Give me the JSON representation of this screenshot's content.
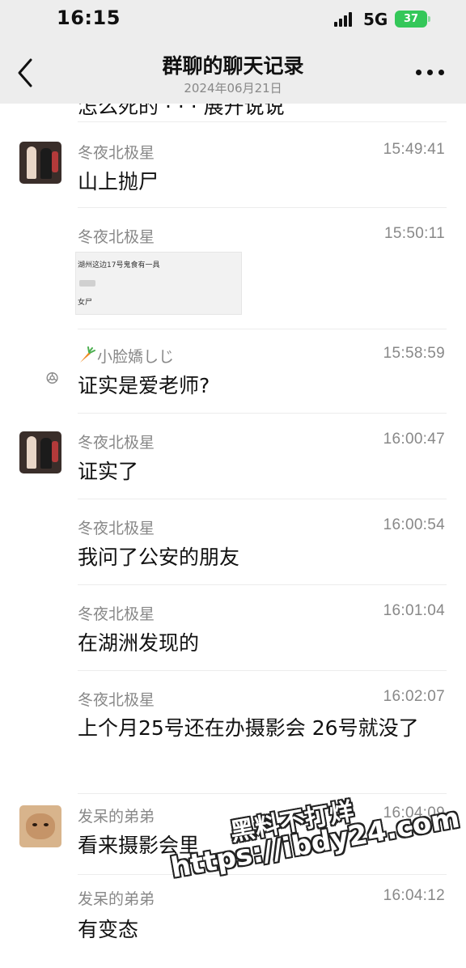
{
  "status_bar": {
    "time": "16:15",
    "network": "5G",
    "battery": "37"
  },
  "nav": {
    "title": "群聊的聊天记录",
    "subtitle": "2024年06月21日"
  },
  "partial_top_text": "怎么死的 · · · 展开说说",
  "messages": [
    {
      "sender": "冬夜北极星",
      "time": "15:49:41",
      "text": "山上抛尸",
      "avatar": "dark"
    },
    {
      "sender": "冬夜北极星",
      "time": "15:50:11",
      "image": {
        "line1": "湖州这边17号鬼食有一具",
        "line2": "女尸"
      }
    },
    {
      "sender": "小脸嬌しじ",
      "time": "15:58:59",
      "text": "证实是爱老师?",
      "avatar": "bunny"
    },
    {
      "sender": "冬夜北极星",
      "time": "16:00:47",
      "text": "证实了",
      "avatar": "dark"
    },
    {
      "sender": "冬夜北极星",
      "time": "16:00:54",
      "text": "我问了公安的朋友"
    },
    {
      "sender": "冬夜北极星",
      "time": "16:01:04",
      "text": "在湖洲发现的"
    },
    {
      "sender": "冬夜北极星",
      "time": "16:02:07",
      "text": "上个月25号还在办摄影会 26号就没了"
    },
    {
      "sender": "发呆的弟弟",
      "time": "16:04:09",
      "text": "看来摄影会里",
      "avatar": "cat"
    },
    {
      "sender": "发呆的弟弟",
      "time": "16:04:12",
      "text": "有变态"
    }
  ],
  "watermark": {
    "line1": "黑料不打烊",
    "line2": "https://ibdy24.com"
  },
  "colors": {
    "header_bg": "#ededed",
    "meta_gray": "#888888",
    "battery_green": "#34c759"
  }
}
